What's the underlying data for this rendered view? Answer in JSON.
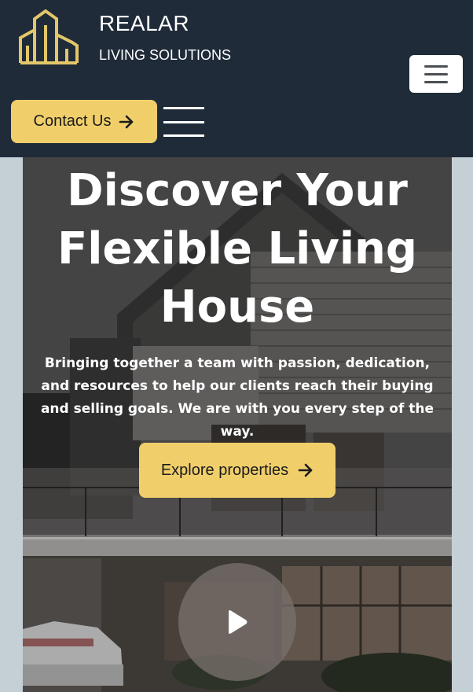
{
  "header": {
    "brand_name": "REALAR",
    "brand_tagline": "LIVING SOLUTIONS",
    "logo_icon": "building-logo-icon",
    "contact_label": "Contact Us",
    "contact_icon": "arrow-right-icon",
    "menu_toggle_icon": "hamburger-icon"
  },
  "hero": {
    "title": "Discover Your Flexible Living House",
    "subtitle": "Bringing together a team with passion, dedication, and resources to help our clients reach their buying and selling goals. We are with you every step of the way.",
    "cta_label": "Explore properties",
    "cta_icon": "arrow-right-icon",
    "play_icon": "play-icon"
  },
  "colors": {
    "header_bg": "#1f2b39",
    "accent": "#f0cf6b",
    "page_bg": "#c5cfd6",
    "text_light": "#ffffff"
  }
}
